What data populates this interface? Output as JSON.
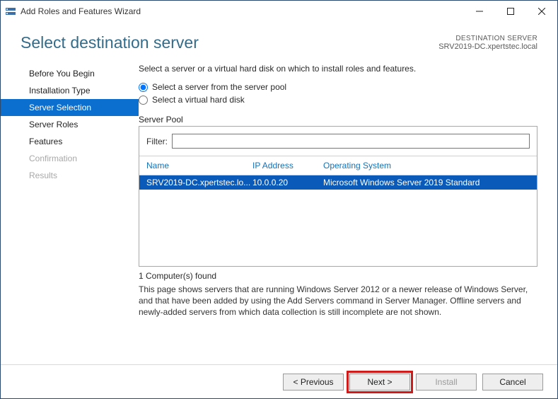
{
  "titlebar": {
    "title": "Add Roles and Features Wizard"
  },
  "header": {
    "title": "Select destination server",
    "dest_label": "DESTINATION SERVER",
    "dest_value": "SRV2019-DC.xpertstec.local"
  },
  "nav": {
    "items": [
      {
        "label": "Before You Begin",
        "state": "normal"
      },
      {
        "label": "Installation Type",
        "state": "normal"
      },
      {
        "label": "Server Selection",
        "state": "active"
      },
      {
        "label": "Server Roles",
        "state": "normal"
      },
      {
        "label": "Features",
        "state": "normal"
      },
      {
        "label": "Confirmation",
        "state": "disabled"
      },
      {
        "label": "Results",
        "state": "disabled"
      }
    ]
  },
  "main": {
    "intro": "Select a server or a virtual hard disk on which to install roles and features.",
    "radios": {
      "pool": "Select a server from the server pool",
      "vhd": "Select a virtual hard disk"
    },
    "pool_section_label": "Server Pool",
    "filter_label": "Filter:",
    "filter_value": "",
    "columns": {
      "name": "Name",
      "ip": "IP Address",
      "os": "Operating System"
    },
    "rows": [
      {
        "name": "SRV2019-DC.xpertstec.lo...",
        "ip": "10.0.0.20",
        "os": "Microsoft Windows Server 2019 Standard"
      }
    ],
    "found_line": "1 Computer(s) found",
    "help_text": "This page shows servers that are running Windows Server 2012 or a newer release of Windows Server, and that have been added by using the Add Servers command in Server Manager. Offline servers and newly-added servers from which data collection is still incomplete are not shown."
  },
  "footer": {
    "previous": "< Previous",
    "next": "Next >",
    "install": "Install",
    "cancel": "Cancel"
  }
}
